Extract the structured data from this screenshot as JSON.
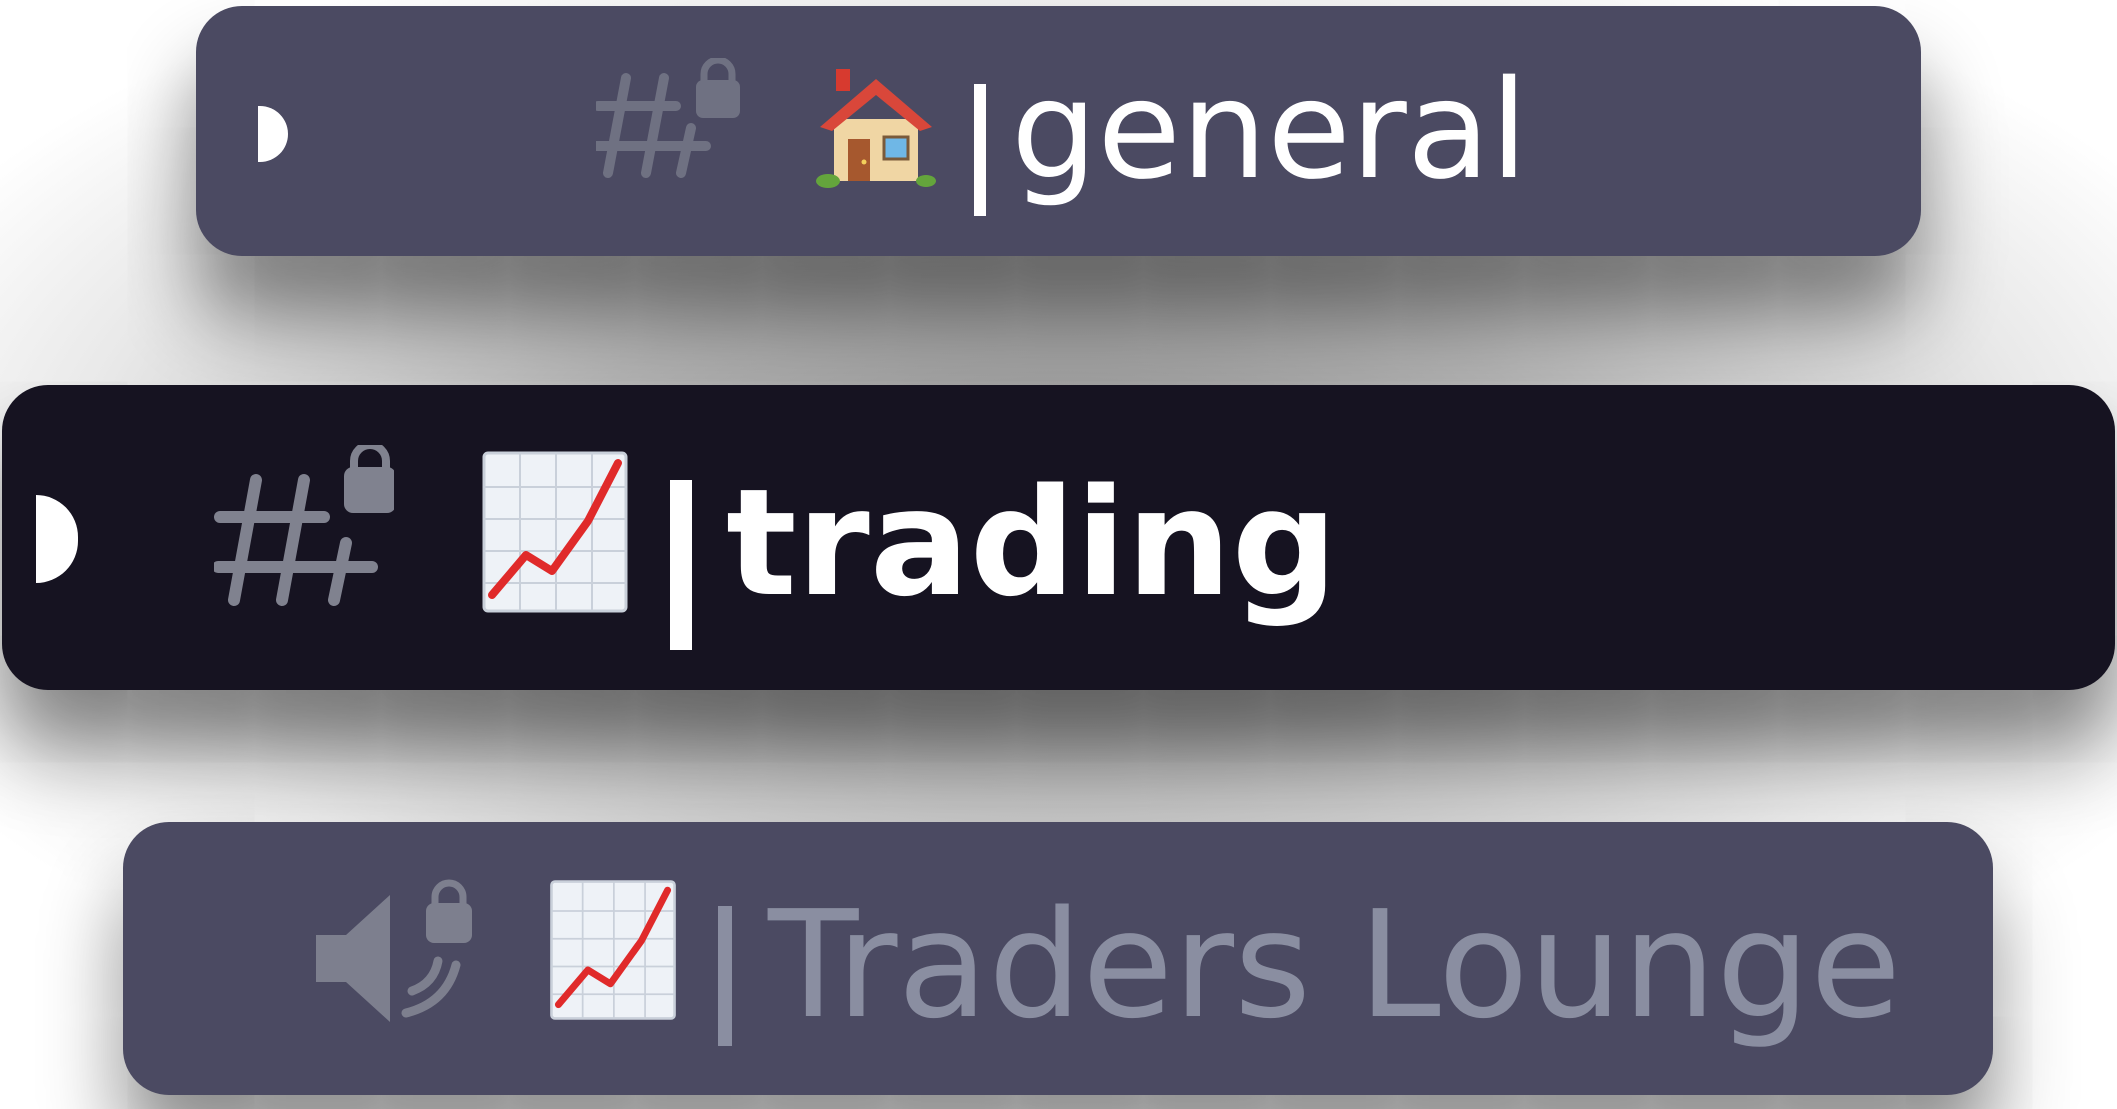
{
  "channels": [
    {
      "type": "text",
      "locked": true,
      "emoji": "house-emoji",
      "separator": "|",
      "name": "general",
      "state": "unread"
    },
    {
      "type": "text",
      "locked": true,
      "emoji": "chart-increasing-emoji",
      "separator": "|",
      "name": "trading",
      "state": "selected"
    },
    {
      "type": "voice",
      "locked": true,
      "emoji": "chart-increasing-emoji",
      "separator": "|",
      "name": "Traders Lounge",
      "state": "muted"
    }
  ],
  "colors": {
    "row_background": "#4b4a62",
    "row_selected_background": "#161321",
    "text_active": "#ffffff",
    "text_muted": "#8a8ea1",
    "icon_muted": "#7d7f8e"
  }
}
